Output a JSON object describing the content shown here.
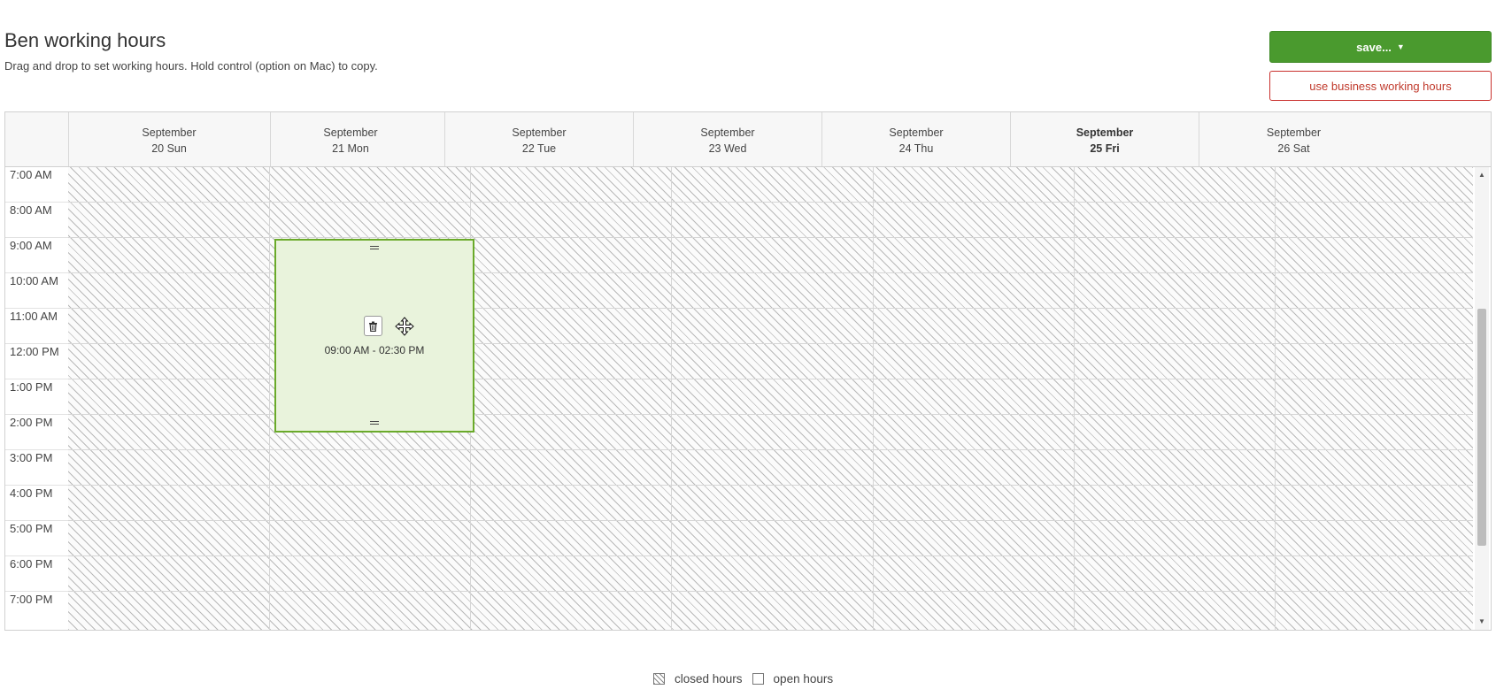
{
  "page": {
    "title": "Ben working hours",
    "subtitle": "Drag and drop to set working hours. Hold control (option on Mac) to copy."
  },
  "actions": {
    "save_label": "save...",
    "business_hours_label": "use business working hours"
  },
  "colors": {
    "save_button": "#4a9a2e",
    "business_button_border": "#c9302c",
    "block_fill": "#e9f3dc",
    "block_border": "#6aaa2a"
  },
  "calendar": {
    "days": [
      {
        "month": "September",
        "date": "20 Sun",
        "today": false
      },
      {
        "month": "September",
        "date": "21 Mon",
        "today": false
      },
      {
        "month": "September",
        "date": "22 Tue",
        "today": false
      },
      {
        "month": "September",
        "date": "23 Wed",
        "today": false
      },
      {
        "month": "September",
        "date": "24 Thu",
        "today": false
      },
      {
        "month": "September",
        "date": "25 Fri",
        "today": true
      },
      {
        "month": "September",
        "date": "26 Sat",
        "today": false
      }
    ],
    "hours": [
      "7:00 AM",
      "8:00 AM",
      "9:00 AM",
      "10:00 AM",
      "11:00 AM",
      "12:00 PM",
      "1:00 PM",
      "2:00 PM",
      "3:00 PM",
      "4:00 PM",
      "5:00 PM",
      "6:00 PM",
      "7:00 PM"
    ],
    "blocks": [
      {
        "day": "21 Mon",
        "label": "09:00 AM - 02:30 PM"
      }
    ]
  },
  "legend": {
    "closed_label": "closed hours",
    "open_label": "open hours"
  }
}
